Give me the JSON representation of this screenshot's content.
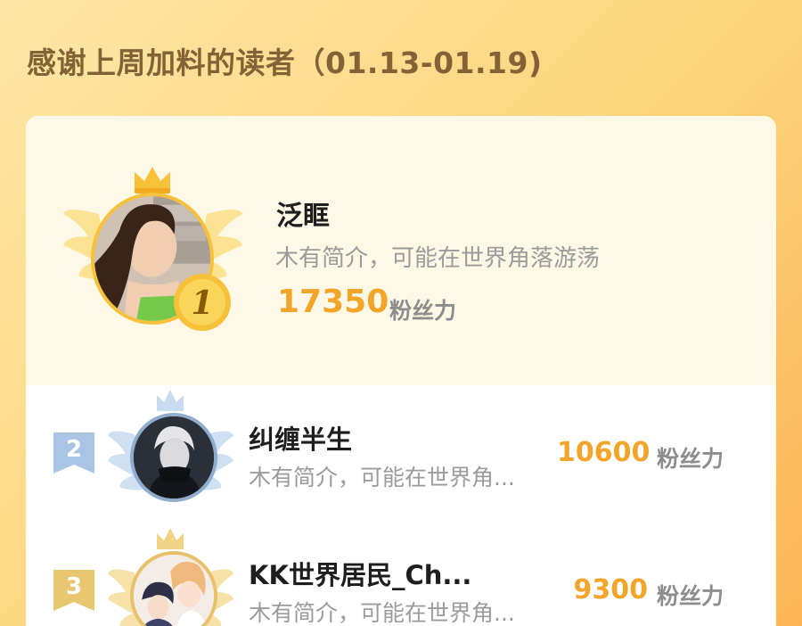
{
  "page": {
    "title": "感谢上周加料的读者（01.13-01.19)"
  },
  "leaderboard": [
    {
      "rank": "1",
      "name": "泛眶",
      "bio": "木有简介，可能在世界角落游荡",
      "score": "17350",
      "unit": "粉丝力",
      "medal_color": "#f8c13a"
    },
    {
      "rank": "2",
      "name": "纠缠半生",
      "bio": "木有简介，可能在世界角...",
      "score": "10600",
      "unit": "粉丝力",
      "medal_color": "#a9c4e4"
    },
    {
      "rank": "3",
      "name": "KK世界居民_Ch...",
      "bio": "木有简介，可能在世界角...",
      "score": "9300",
      "unit": "粉丝力",
      "medal_color": "#e9c670"
    }
  ],
  "colors": {
    "title": "#836336",
    "score": "#f3a52a",
    "gold": "#f8c13a",
    "silver": "#a9c4e4",
    "bronze": "#e9c670"
  },
  "icons": [
    "crown-icon",
    "wings-icon",
    "rank-medal-icon",
    "rank-flag-icon"
  ]
}
